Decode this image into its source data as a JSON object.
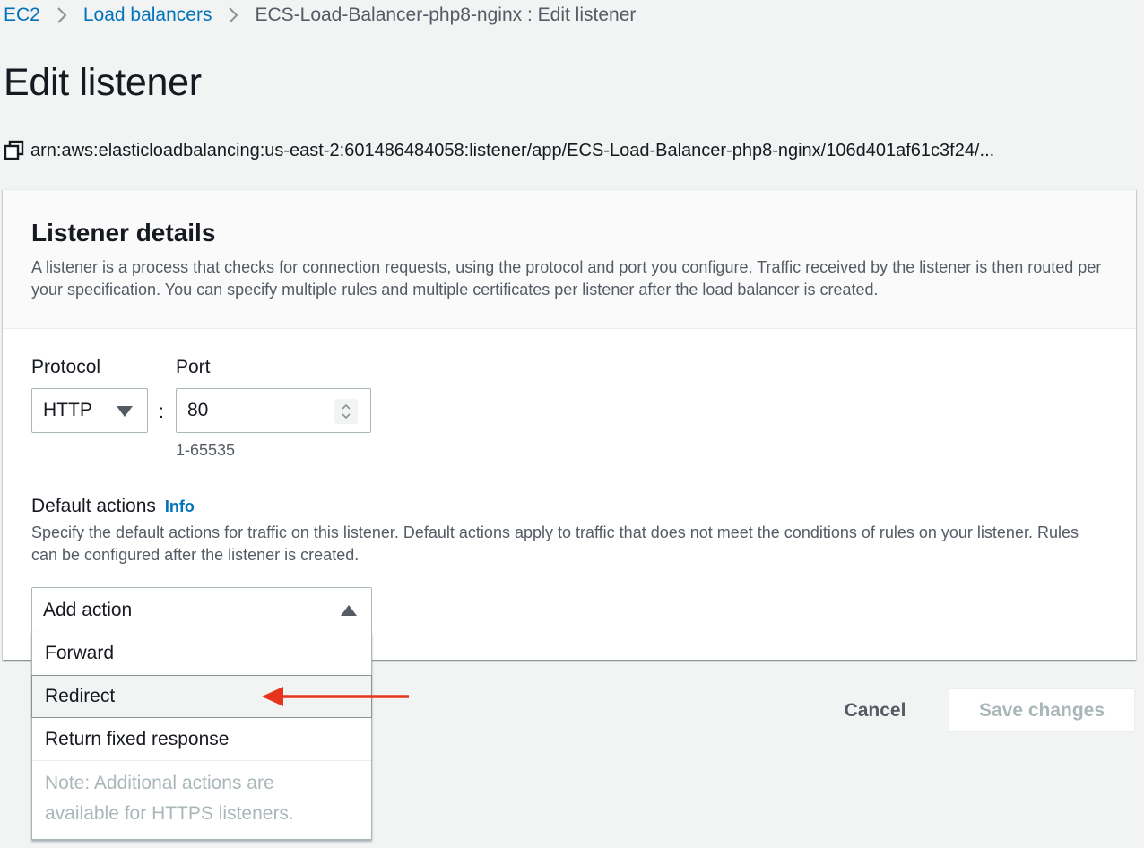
{
  "breadcrumb": {
    "items": [
      "EC2",
      "Load balancers"
    ],
    "current": "ECS-Load-Balancer-php8-nginx : Edit listener"
  },
  "page": {
    "title": "Edit listener",
    "arn": "arn:aws:elasticloadbalancing:us-east-2:601486484058:listener/app/ECS-Load-Balancer-php8-nginx/106d401af61c3f24/..."
  },
  "listener": {
    "title": "Listener details",
    "description": "A listener is a process that checks for connection requests, using the protocol and port you configure. Traffic received by the listener is then routed per your specification. You can specify multiple rules and multiple certificates per listener after the load balancer is created.",
    "protocol_label": "Protocol",
    "protocol_value": "HTTP",
    "port_label": "Port",
    "port_value": "80",
    "port_hint": "1-65535",
    "separator": ":"
  },
  "default_actions": {
    "label": "Default actions",
    "info": "Info",
    "description": "Specify the default actions for traffic on this listener. Default actions apply to traffic that does not meet the conditions of rules on your listener. Rules can be configured after the listener is created.",
    "select_placeholder": "Add action",
    "options": [
      "Forward",
      "Redirect",
      "Return fixed response"
    ],
    "highlighted_option": "Redirect",
    "note": "Note: Additional actions are available for HTTPS listeners."
  },
  "footer": {
    "cancel": "Cancel",
    "save": "Save changes"
  },
  "colors": {
    "link": "#0073bb",
    "annotation_arrow": "#e8341c",
    "disabled_text": "#aab7b8"
  }
}
